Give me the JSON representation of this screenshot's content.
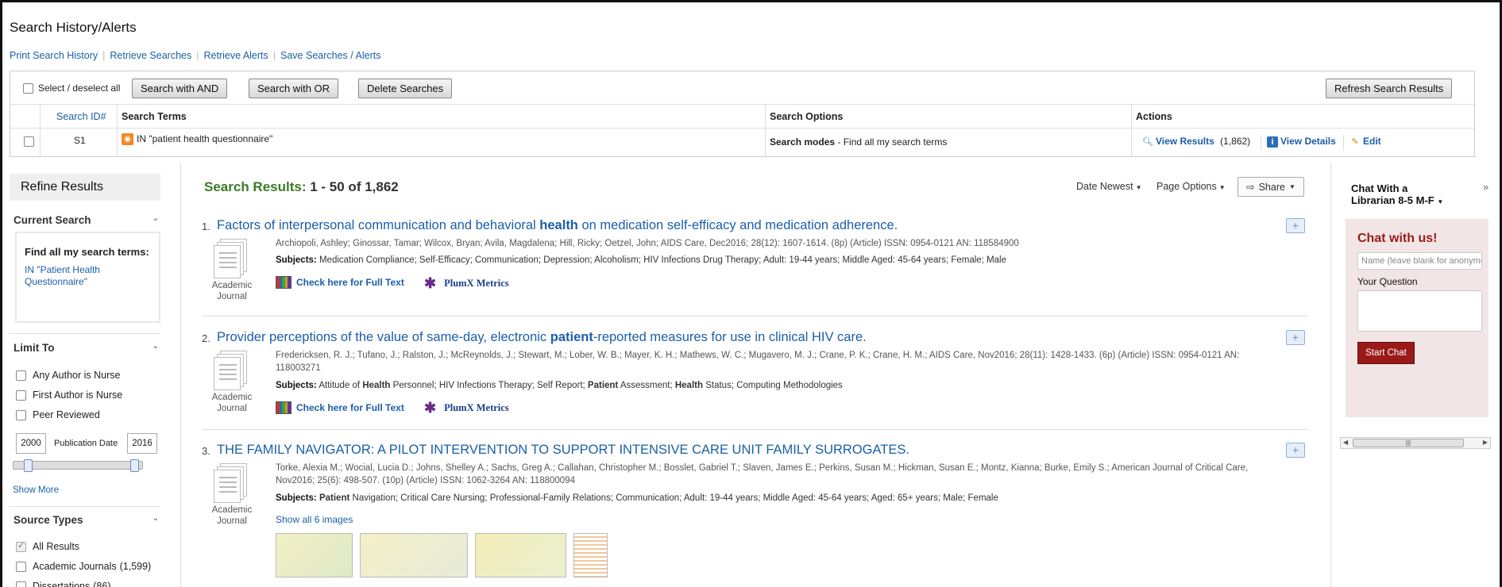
{
  "search_history": {
    "title": "Search History/Alerts",
    "links": [
      "Print Search History",
      "Retrieve Searches",
      "Retrieve Alerts",
      "Save Searches / Alerts"
    ],
    "select_all_label": "Select / deselect all",
    "buttons": {
      "search_and": "Search with AND",
      "search_or": "Search with OR",
      "delete": "Delete Searches",
      "refresh": "Refresh Search Results"
    },
    "columns": {
      "id": "Search ID#",
      "terms": "Search Terms",
      "options": "Search Options",
      "actions": "Actions"
    },
    "row": {
      "id": "S1",
      "terms": "IN \"patient health questionnaire\"",
      "options_label": "Search modes",
      "options_value": " - Find all my search terms",
      "view_results": "View Results",
      "view_results_count": "(1,862)",
      "view_details": "View Details",
      "edit": "Edit"
    }
  },
  "sidebar": {
    "refine_title": "Refine Results",
    "current_search_head": "Current Search",
    "find_all": "Find all my search terms:",
    "current_term": "IN \"Patient Health Questionnaire\"",
    "limit_to_head": "Limit To",
    "limits": [
      "Any Author is Nurse",
      "First Author is Nurse",
      "Peer Reviewed"
    ],
    "pub_date_label": "Publication Date",
    "year_from": "2000",
    "year_to": "2016",
    "show_more": "Show More",
    "source_types_head": "Source Types",
    "sources": [
      {
        "label": "All Results",
        "count": "",
        "checked": true
      },
      {
        "label": "Academic Journals",
        "count": "(1,599)",
        "checked": false
      },
      {
        "label": "Dissertations",
        "count": "(86)",
        "checked": false
      }
    ]
  },
  "results": {
    "label": "Search Results:",
    "range": "1 - 50 of 1,862",
    "sort": "Date Newest",
    "page_options": "Page Options",
    "share": "Share",
    "fulltext_label": "Check here for Full Text",
    "plumx_label": "PlumX Metrics",
    "subjects_label": "Subjects:",
    "type_label_1": "Academic",
    "type_label_2": "Journal",
    "items": [
      {
        "num": "1.",
        "title_a": "Factors of interpersonal communication and behavioral ",
        "title_b": "health",
        "title_c": " on medication self-efficacy and medication adherence.",
        "authors": "Archiopoli, Ashley; Ginossar, Tamar; Wilcox, Bryan; Avila, Magdalena; Hill, Ricky; Oetzel, John; AIDS Care, Dec2016; 28(12): 1607-1614. (8p) (Article) ISSN: 0954-0121 AN: 118584900",
        "subjects": "Medication Compliance; Self-Efficacy; Communication; Depression; Alcoholism; HIV Infections Drug Therapy; Adult: 19-44 years; Middle Aged: 45-64 years; Female; Male"
      },
      {
        "num": "2.",
        "title_a": "Provider perceptions of the value of same-day, electronic ",
        "title_b": "patient",
        "title_c": "-reported measures for use in clinical HIV care.",
        "authors": "Fredericksen, R. J.; Tufano, J.; Ralston, J.; McReynolds, J.; Stewart, M.; Lober, W. B.; Mayer, K. H.; Mathews, W. C.; Mugavero, M. J.; Crane, P. K.; Crane, H. M.; AIDS Care, Nov2016; 28(11): 1428-1433. (6p) (Article) ISSN: 0954-0121 AN: 118003271",
        "subjects_parts": [
          {
            "t": "Attitude of ",
            "b": false
          },
          {
            "t": "Health",
            "b": true
          },
          {
            "t": " Personnel; HIV Infections Therapy; Self Report; ",
            "b": false
          },
          {
            "t": "Patient",
            "b": true
          },
          {
            "t": " Assessment; ",
            "b": false
          },
          {
            "t": "Health",
            "b": true
          },
          {
            "t": " Status; Computing Methodologies",
            "b": false
          }
        ]
      },
      {
        "num": "3.",
        "title_a": "THE FAMILY NAVIGATOR: A PILOT INTERVENTION TO SUPPORT INTENSIVE CARE UNIT FAMILY SURROGATES.",
        "title_b": "",
        "title_c": "",
        "authors": "Torke, Alexia M.; Wocial, Lucia D.; Johns, Shelley A.; Sachs, Greg A.; Callahan, Christopher M.; Bosslet, Gabriel T.; Slaven, James E.; Perkins, Susan M.; Hickman, Susan E.; Montz, Kianna; Burke, Emily S.; American Journal of Critical Care, Nov2016; 25(6): 498-507. (10p) (Article) ISSN: 1062-3264 AN: 118800094",
        "subjects_bold": "Patient",
        "subjects": " Navigation; Critical Care Nursing; Professional-Family Relations; Communication; Adult: 19-44 years; Middle Aged: 45-64 years; Aged: 65+ years; Male; Female",
        "show_images": "Show all 6 images"
      }
    ]
  },
  "chat": {
    "title": "Chat With a Librarian 8-5 M-F",
    "heading": "Chat with us!",
    "name_placeholder": "Name (leave blank for anonymous)",
    "question_label": "Your Question",
    "start": "Start Chat"
  }
}
